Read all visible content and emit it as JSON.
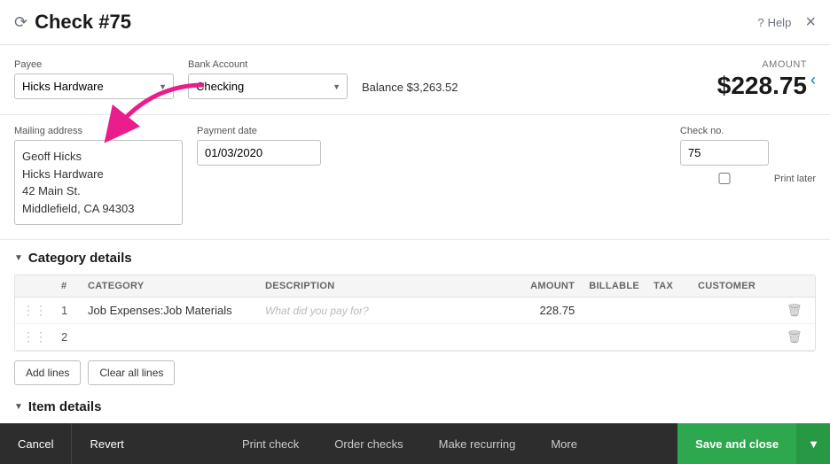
{
  "header": {
    "icon": "⟳",
    "title": "Check #75",
    "help_label": "Help",
    "close_label": "×"
  },
  "payee": {
    "label": "Payee",
    "value": "Hicks Hardware"
  },
  "bank_account": {
    "label": "Bank Account",
    "value": "Checking",
    "balance_label": "Balance",
    "balance_value": "$3,263.52"
  },
  "amount": {
    "label": "AMOUNT",
    "value": "$228.75"
  },
  "mailing_address": {
    "label": "Mailing address",
    "lines": [
      "Geoff Hicks",
      "Hicks Hardware",
      "42 Main St.",
      "Middlefield, CA  94303"
    ]
  },
  "payment_date": {
    "label": "Payment date",
    "value": "01/03/2020"
  },
  "check_no": {
    "label": "Check no.",
    "value": "75"
  },
  "print_later": {
    "label": "Print later"
  },
  "category_details": {
    "header": "Category details",
    "table": {
      "columns": [
        "#",
        "CATEGORY",
        "DESCRIPTION",
        "AMOUNT",
        "BILLABLE",
        "TAX",
        "CUSTOMER"
      ],
      "rows": [
        {
          "num": 1,
          "category": "Job Expenses:Job Materials",
          "description": "",
          "description_placeholder": "What did you pay for?",
          "amount": "228.75",
          "billable": "",
          "tax": "",
          "customer": ""
        },
        {
          "num": 2,
          "category": "",
          "description": "",
          "description_placeholder": "",
          "amount": "",
          "billable": "",
          "tax": "",
          "customer": ""
        }
      ]
    },
    "add_lines_label": "Add lines",
    "clear_all_label": "Clear all lines"
  },
  "item_details": {
    "header": "Item details"
  },
  "footer": {
    "cancel_label": "Cancel",
    "revert_label": "Revert",
    "print_check_label": "Print check",
    "order_checks_label": "Order checks",
    "make_recurring_label": "Make recurring",
    "more_label": "More",
    "save_close_label": "Save and close"
  },
  "annotation_arrow": {
    "points_to": "Checking bank account dropdown"
  }
}
